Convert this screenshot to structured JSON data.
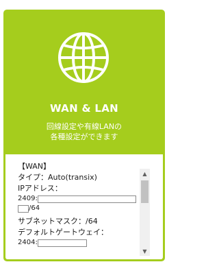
{
  "card": {
    "title": "WAN & LAN",
    "description_line1": "回線設定や有線LANの",
    "description_line2": "各種設定ができます",
    "icon": "globe-icon",
    "accent_color": "#a5cd1d"
  },
  "wan_info": {
    "section_header": "【WAN】",
    "type_line": "タイプ：Auto(transix)",
    "ip_label": "IPアドレス：",
    "ip_prefix": "2409:",
    "ip_suffix": "/64",
    "subnet_line": "サブネットマスク：/64",
    "gateway_label": "デフォルトゲートウェイ：",
    "gateway_prefix": "2404:"
  },
  "scrollbar": {
    "up_icon": "chevron-up-icon",
    "down_icon": "chevron-down-icon"
  }
}
